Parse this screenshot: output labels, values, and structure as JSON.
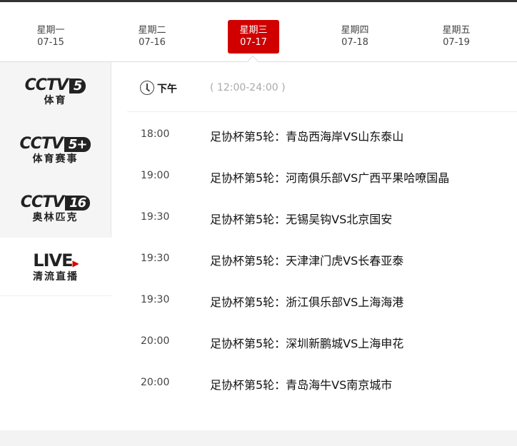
{
  "days": [
    {
      "weekday": "星期一",
      "date": "07-15"
    },
    {
      "weekday": "星期二",
      "date": "07-16"
    },
    {
      "weekday": "星期三",
      "date": "07-17",
      "active": true
    },
    {
      "weekday": "星期四",
      "date": "07-18"
    },
    {
      "weekday": "星期五",
      "date": "07-19"
    }
  ],
  "channels": [
    {
      "top": "CCTV",
      "num": "5",
      "sub": "体育"
    },
    {
      "top": "CCTV",
      "num": "5+",
      "sub": "体育赛事"
    },
    {
      "top": "CCTV",
      "num": "16",
      "sub": "奥林匹克"
    },
    {
      "top": "LIVE",
      "sub": "清流直播"
    }
  ],
  "period": {
    "label": "下午",
    "range": "( 12:00-24:00 )"
  },
  "programs": [
    {
      "time": "18:00",
      "title": "足协杯第5轮：青岛西海岸VS山东泰山"
    },
    {
      "time": "19:00",
      "title": "足协杯第5轮：河南俱乐部VS广西平果哈嘹国晶"
    },
    {
      "time": "19:30",
      "title": "足协杯第5轮：无锡吴钩VS北京国安"
    },
    {
      "time": "19:30",
      "title": "足协杯第5轮：天津津门虎VS长春亚泰"
    },
    {
      "time": "19:30",
      "title": "足协杯第5轮：浙江俱乐部VS上海海港"
    },
    {
      "time": "20:00",
      "title": "足协杯第5轮：深圳新鹏城VS上海申花"
    },
    {
      "time": "20:00",
      "title": "足协杯第5轮：青岛海牛VS南京城市"
    }
  ],
  "colors": {
    "accent": "#d00000"
  }
}
